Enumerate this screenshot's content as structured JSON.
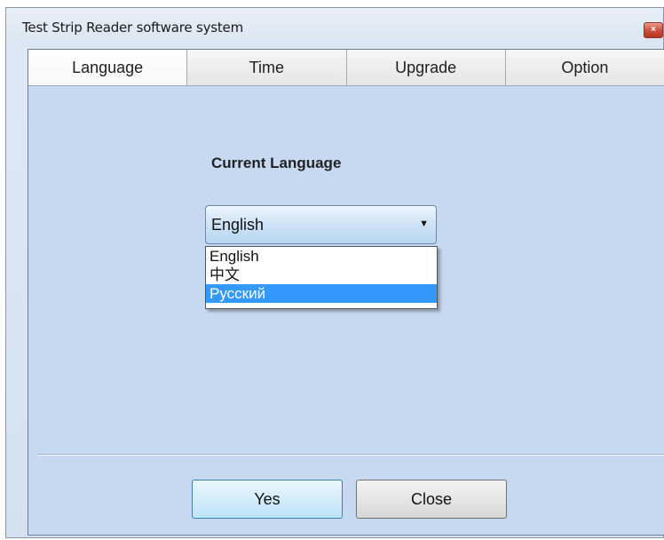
{
  "window": {
    "title": "Test Strip Reader software system",
    "close_glyph": "×"
  },
  "tabs": [
    {
      "label": "Language",
      "active": true
    },
    {
      "label": "Time",
      "active": false
    },
    {
      "label": "Upgrade",
      "active": false
    },
    {
      "label": "Option",
      "active": false
    }
  ],
  "language_panel": {
    "heading": "Current Language",
    "selected": "English",
    "caret": "▼",
    "options": [
      "English",
      "中文",
      "Русский"
    ],
    "highlighted_option": "Русский"
  },
  "buttons": {
    "yes": "Yes",
    "close": "Close"
  },
  "colors": {
    "highlight": "#3399ff",
    "panel_background": "#c6d9f0"
  }
}
